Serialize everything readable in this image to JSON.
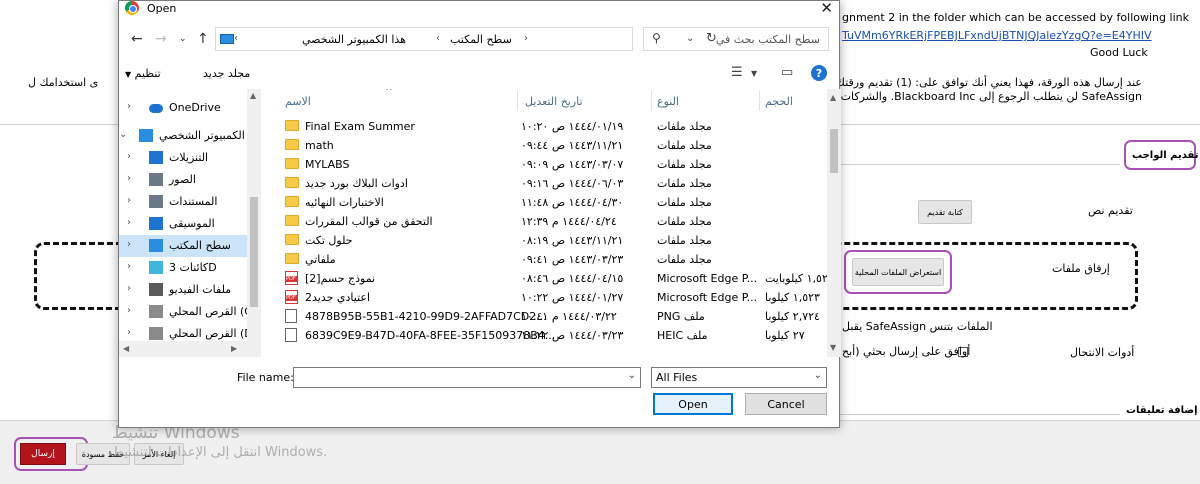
{
  "background": {
    "top_text": "gnment 2 in the folder which can be accessed by following link",
    "link": "TuVMm6YRkERjFPEBJLFxndUjBTNJQJalezYzgQ?e=E4YHIV",
    "good_luck": "Good Luck",
    "agreement_line1": "عند إرسال هذه الورقة، فهذا يعني أنك توافق على: (1) تقديم ورقتك ليتم",
    "agreement_line2": "SafeAssign لن يتطلب الرجوع إلى Blackboard Inc. والشركات التابعة",
    "agreement_tail": "ى استخدامك ل",
    "section_submit": "تقديم الواجب",
    "submit_text_label": "تقديم نص",
    "write_submission_btn": "كتابة تقديم",
    "attach_files_label": "إرفاق ملفات",
    "browse_local_btn": "استعراض الملفات المحلية",
    "safeassign_accepts": "يقبل SafeAssign الملفات بتنس",
    "plagiarism_tools": "أدوات الانتحال",
    "agree_checkbox_text": "أوافق على إرسال بحثي (أبح",
    "add_comments": "إضافة تعليقات",
    "bottom_btn_submit": "إرسال",
    "bottom_btn_save": "حفظ مسودة",
    "bottom_btn_cancel": "إلغاء الأمر",
    "watermark_line1": "تنشيط Windows",
    "watermark_line2": "انتقل إلى الإعدادات لتنشيط Windows."
  },
  "dialog": {
    "title": "Open",
    "breadcrumb": [
      "هذا الكمبيوتر الشخصي",
      "سطح المكتب"
    ],
    "search_placeholder": "سطح المكتب بحث في",
    "toolbar_organize": "تنظيم",
    "toolbar_new_folder": "مجلد جديد",
    "nav_items": [
      {
        "label": "OneDrive",
        "icon": "cloud-icon"
      },
      {
        "label": "الكمبيوتر الشخصي",
        "icon": "pc-icon"
      },
      {
        "label": "التنزيلات",
        "icon": "download-icon"
      },
      {
        "label": "الصور",
        "icon": "pictures-icon"
      },
      {
        "label": "المستندات",
        "icon": "documents-icon"
      },
      {
        "label": "الموسيقى",
        "icon": "music-icon"
      },
      {
        "label": "سطح المكتب",
        "icon": "desktop-icon"
      },
      {
        "label": "كائنات 3D",
        "icon": "3d-objects-icon"
      },
      {
        "label": "ملفات الفيديو",
        "icon": "video-icon"
      },
      {
        "label": "القرص المحلي (C",
        "icon": "drive-icon"
      },
      {
        "label": "القرص المحلي (D",
        "icon": "drive-icon"
      }
    ],
    "columns": {
      "name": "الاسم",
      "date": "تاريخ التعديل",
      "type": "النوع",
      "size": "الحجم"
    },
    "files": [
      {
        "name": "Final Exam Summer",
        "date": "١٤٤٤/٠١/١٩ ص ١٠:٢٠",
        "type": "مجلد ملفات",
        "size": "",
        "icon": "folder"
      },
      {
        "name": "math",
        "date": "١٤٤٣/١١/٢١ ص ٠٩:٤٤",
        "type": "مجلد ملفات",
        "size": "",
        "icon": "folder"
      },
      {
        "name": "MYLABS",
        "date": "١٤٤٣/٠٣/٠٧ ص ٠٩:٠٩",
        "type": "مجلد ملفات",
        "size": "",
        "icon": "folder"
      },
      {
        "name": "ادوات البلاك بورد جديد",
        "date": "١٤٤٤/٠٦/٠٣ ص ٠٩:١٦",
        "type": "مجلد ملفات",
        "size": "",
        "icon": "folder"
      },
      {
        "name": "الاختبارات النهائيه",
        "date": "١٤٤٤/٠٤/٣٠ ص ١١:٤٨",
        "type": "مجلد ملفات",
        "size": "",
        "icon": "folder"
      },
      {
        "name": "التحقق من قوالب المقررات",
        "date": "١٤٤٤/٠٤/٢٤ م ١٢:٣٩",
        "type": "مجلد ملفات",
        "size": "",
        "icon": "folder"
      },
      {
        "name": "حلول تكت",
        "date": "١٤٤٣/١١/٢١ ص ٠٨:١٩",
        "type": "مجلد ملفات",
        "size": "",
        "icon": "folder"
      },
      {
        "name": "ملفاتي",
        "date": "١٤٤٣/٠٣/٢٣ ص ٠٩:٤١",
        "type": "مجلد ملفات",
        "size": "",
        "icon": "folder"
      },
      {
        "name": "نموذج حسم[2]",
        "date": "١٤٤٤/٠٤/١٥ ص ٠٨:٤٦",
        "type": "Microsoft Edge P...",
        "size": "١,٥٢١ كيلوبايت",
        "icon": "pdf"
      },
      {
        "name": "2اعتيادي جديد",
        "date": "١٤٤٤/٠١/٢٧ ص ١٠:٢٢",
        "type": "Microsoft Edge P...",
        "size": "١,٥٢٣ كيلوبا",
        "icon": "pdf"
      },
      {
        "name": "4878B95B-55B1-4210-99D9-2AFFAD7CD2...",
        "date": "١٤٤٤/٠٣/٢٢ م ١٠:٤١",
        "type": "PNG ملف",
        "size": "٢,٧٢٤ كيلوبا",
        "icon": "image"
      },
      {
        "name": "6839C9E9-B47D-40FA-8FEE-35F1509378B4...",
        "date": "١٤٤٤/٠٣/٢٣ ص ١١:٢٢",
        "type": "HEIC ملف",
        "size": "٢٧ كيلوبا",
        "icon": "image"
      }
    ],
    "file_name_label": "File name:",
    "file_name_value": "",
    "file_type_value": "All Files",
    "open_btn": "Open",
    "cancel_btn": "Cancel"
  },
  "colors": {
    "annotation_purple": "#a653b5",
    "submit_red": "#b3141b",
    "selected_blue": "#cce4f7",
    "accent_blue": "#0078d7"
  }
}
